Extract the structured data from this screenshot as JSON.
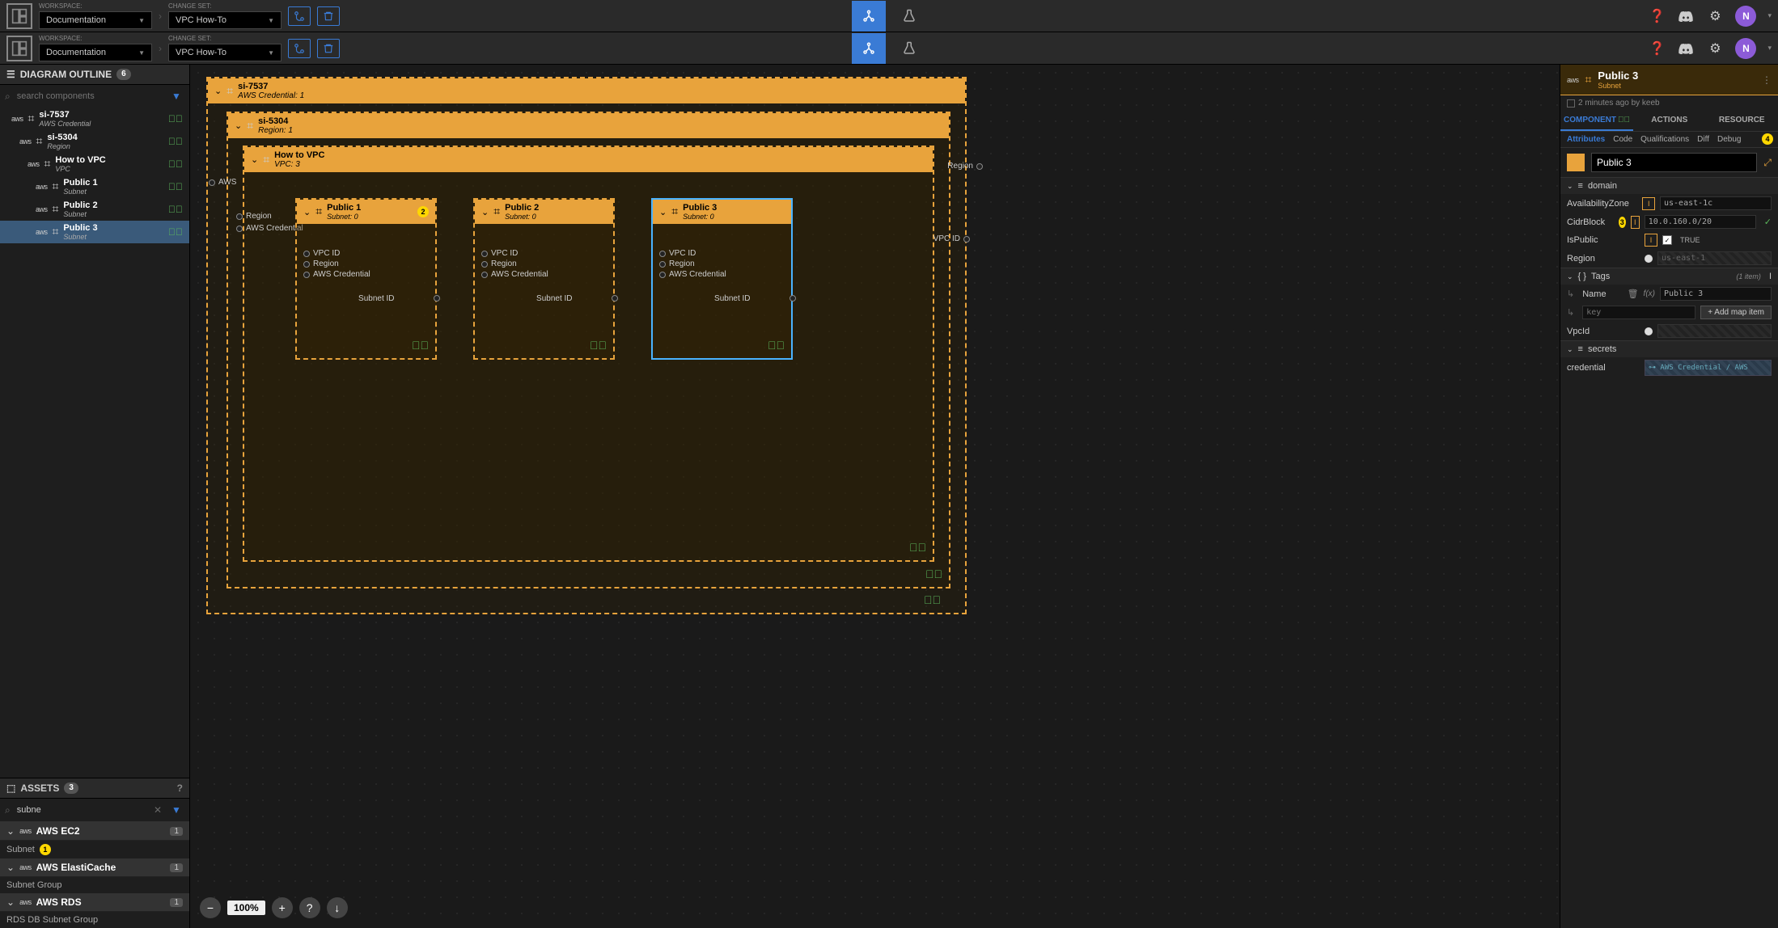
{
  "topbar": {
    "workspace_label": "WORKSPACE:",
    "workspace_value": "Documentation",
    "changeset_label": "CHANGE SET:",
    "changeset_value": "VPC How-To",
    "avatar_letter": "N"
  },
  "left": {
    "outline_title": "DIAGRAM OUTLINE",
    "outline_count": "6",
    "search_placeholder": "search components",
    "tree": [
      {
        "title": "si-7537",
        "sub": "AWS Credential",
        "indent": 0
      },
      {
        "title": "si-5304",
        "sub": "Region",
        "indent": 1
      },
      {
        "title": "How to VPC",
        "sub": "VPC",
        "indent": 2
      },
      {
        "title": "Public 1",
        "sub": "Subnet",
        "indent": 3
      },
      {
        "title": "Public 2",
        "sub": "Subnet",
        "indent": 3
      },
      {
        "title": "Public 3",
        "sub": "Subnet",
        "indent": 3
      }
    ],
    "assets_title": "ASSETS",
    "assets_count": "3",
    "assets_search": "subne",
    "asset_cats": [
      {
        "name": "AWS EC2",
        "count": "1",
        "items": [
          {
            "name": "Subnet",
            "badge": "1"
          }
        ]
      },
      {
        "name": "AWS ElastiCache",
        "count": "1",
        "items": [
          {
            "name": "Subnet Group"
          }
        ]
      },
      {
        "name": "AWS RDS",
        "count": "1",
        "items": [
          {
            "name": "RDS DB Subnet Group"
          }
        ]
      }
    ]
  },
  "canvas": {
    "f1": {
      "title": "si-7537",
      "sub": "AWS Credential: 1"
    },
    "f2": {
      "title": "si-5304",
      "sub": "Region: 1"
    },
    "f3": {
      "title": "How to VPC",
      "sub": "VPC: 3"
    },
    "subnets": [
      {
        "title": "Public 1",
        "sub": "Subnet: 0",
        "badge": "2"
      },
      {
        "title": "Public 2",
        "sub": "Subnet: 0"
      },
      {
        "title": "Public 3",
        "sub": "Subnet: 0"
      }
    ],
    "ports_in": [
      "VPC ID",
      "Region",
      "AWS Credential"
    ],
    "port_out": "Subnet ID",
    "vpc_ports_l": [
      "Region",
      "AWS Credential"
    ],
    "vpc_port_r": "VPC ID",
    "region_port_r": "Region",
    "region_port_l": "AWS",
    "zoom": "100%"
  },
  "right": {
    "header_title": "Public 3",
    "header_sub": "Subnet",
    "meta": "2 minutes ago by keeb",
    "tabs": [
      "COMPONENT",
      "ACTIONS",
      "RESOURCE"
    ],
    "subtabs": [
      "Attributes",
      "Code",
      "Qualifications",
      "Diff",
      "Debug"
    ],
    "subtab_badge": "4",
    "name_input": "Public 3",
    "sec_domain": "domain",
    "attrs": {
      "az_label": "AvailabilityZone",
      "az_val": "us-east-1c",
      "cidr_label": "CidrBlock",
      "cidr_badge": "3",
      "cidr_val": "10.0.160.0/20",
      "ispub_label": "IsPublic",
      "ispub_val": "TRUE",
      "region_label": "Region",
      "region_val": "us-east-1",
      "vpcid_label": "VpcId"
    },
    "sec_tags": "Tags",
    "tags_meta": "(1 item)",
    "tag_name_label": "Name",
    "tag_name_val": "Public 3",
    "tag_key_ph": "key",
    "tag_add": "+ Add map item",
    "sec_secrets": "secrets",
    "cred_label": "credential",
    "cred_val": "⊶ AWS Credential / AWS"
  }
}
